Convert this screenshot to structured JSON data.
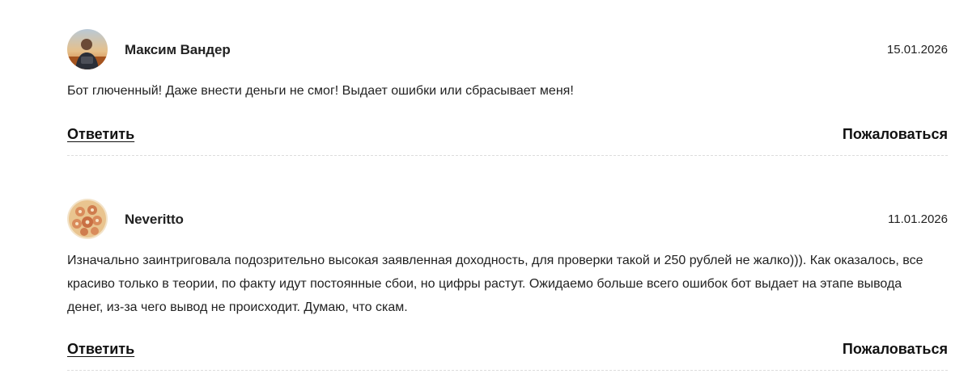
{
  "comments": [
    {
      "author": "Максим Вандер",
      "date": "15.01.2026",
      "text": "Бот глюченный! Даже внести деньги не смог! Выдает ошибки или сбрасывает меня!",
      "reply_label": "Ответить",
      "report_label": "Пожаловаться"
    },
    {
      "author": "Neveritto",
      "date": "11.01.2026",
      "text": "Изначально заинтриговала подозрительно высокая заявленная доходность, для проверки такой и 250 рублей не жалко))). Как оказалось, все красиво только в теории, по факту идут постоянные сбои, но цифры растут. Ожидаемо больше всего ошибок бот выдает на этапе вывода денег, из-за чего вывод не происходит. Думаю, что скам.",
      "reply_label": "Ответить",
      "report_label": "Пожаловаться"
    }
  ]
}
